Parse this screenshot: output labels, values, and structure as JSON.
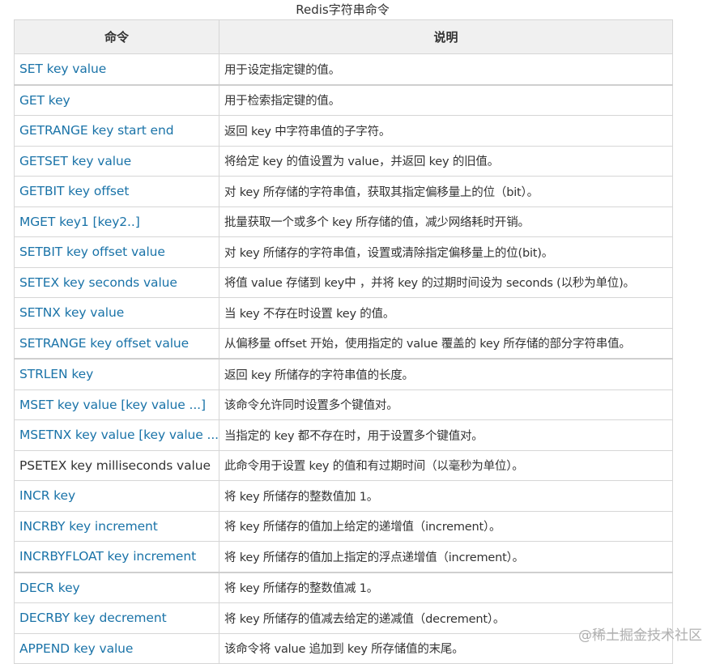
{
  "caption": "Redis字符串命令",
  "table": {
    "headers": [
      "命令",
      "说明"
    ],
    "rows": [
      {
        "command": "SET key value",
        "description": "用于设定指定键的值。",
        "link": true
      },
      {
        "command": "GET key",
        "description": "用于检索指定键的值。",
        "link": true
      },
      {
        "command": "GETRANGE key start end",
        "description": "返回 key 中字符串值的子字符。",
        "link": true
      },
      {
        "command": "GETSET key value",
        "description": "将给定 key 的值设置为 value，并返回 key 的旧值。",
        "link": true
      },
      {
        "command": "GETBIT key offset",
        "description": "对 key 所存储的字符串值，获取其指定偏移量上的位（bit）。",
        "link": true
      },
      {
        "command": "MGET key1 [key2..]",
        "description": "批量获取一个或多个 key 所存储的值，减少网络耗时开销。",
        "link": true
      },
      {
        "command": "SETBIT key offset value",
        "description": "对 key 所储存的字符串值，设置或清除指定偏移量上的位(bit)。",
        "link": true
      },
      {
        "command": "SETEX key seconds value",
        "description": "将值 value 存储到 key中 ，并将 key 的过期时间设为 seconds (以秒为单位)。",
        "link": true
      },
      {
        "command": "SETNX key value",
        "description": "当 key 不存在时设置 key 的值。",
        "link": true
      },
      {
        "command": "SETRANGE key offset value",
        "description": "从偏移量 offset 开始，使用指定的 value 覆盖的 key 所存储的部分字符串值。",
        "link": true
      },
      {
        "command": "STRLEN key",
        "description": "返回 key 所储存的字符串值的长度。",
        "link": true
      },
      {
        "command": "MSET key value [key value ...]",
        "description": "该命令允许同时设置多个键值对。",
        "link": true
      },
      {
        "command": "MSETNX key value [key value ...]",
        "description": "当指定的 key 都不存在时，用于设置多个键值对。",
        "link": true
      },
      {
        "command": "PSETEX key milliseconds value",
        "description": "此命令用于设置 key 的值和有过期时间（以毫秒为单位）。",
        "link": false
      },
      {
        "command": "INCR key",
        "description": "将 key 所储存的整数值加 1。",
        "link": true
      },
      {
        "command": "INCRBY key increment",
        "description": "将 key 所储存的值加上给定的递增值（increment）。",
        "link": true
      },
      {
        "command": "INCRBYFLOAT key increment",
        "description": "将 key 所储存的值加上指定的浮点递增值（increment）。",
        "link": true
      },
      {
        "command": "DECR key",
        "description": "将 key 所储存的整数值减 1。",
        "link": true
      },
      {
        "command": "DECRBY key decrement",
        "description": "将 key 所储存的值减去给定的递减值（decrement）。",
        "link": true
      },
      {
        "command": "APPEND key value",
        "description": "该命令将 value 追加到 key 所存储值的末尾。",
        "link": true
      }
    ]
  },
  "watermark": "@稀土掘金技术社区",
  "colors": {
    "link": "#1a73a8",
    "text": "#333333",
    "header_bg": "#f0f0f0",
    "border": "#d6d6d6"
  }
}
